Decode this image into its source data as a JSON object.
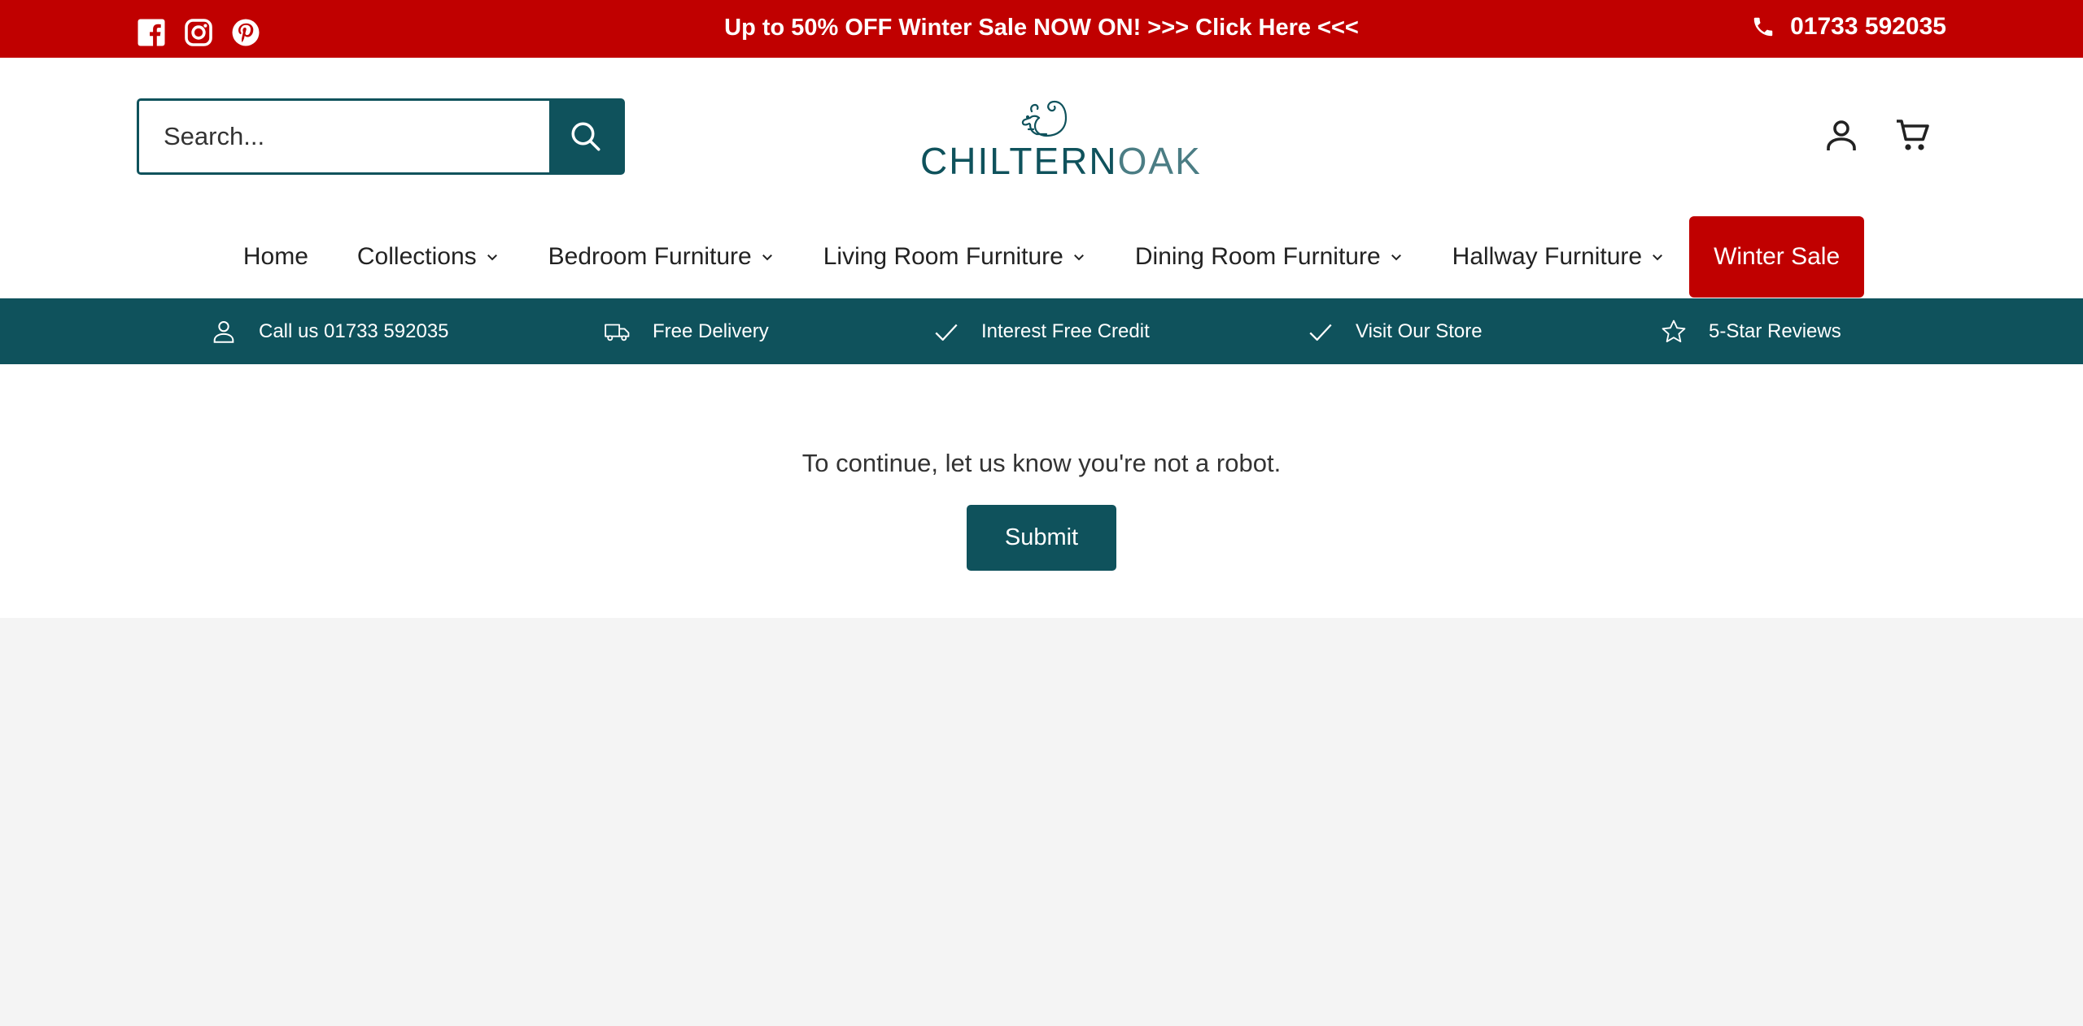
{
  "announcement": {
    "message": "Up to 50% OFF Winter Sale NOW ON! >>> Click Here <<<",
    "phone": "01733 592035",
    "social": [
      "facebook-icon",
      "instagram-icon",
      "pinterest-icon"
    ]
  },
  "header": {
    "search": {
      "placeholder": "Search..."
    },
    "logo": {
      "part1": "CHILTERN",
      "part2": "OAK"
    },
    "icons": [
      "account-icon",
      "cart-icon"
    ]
  },
  "nav": {
    "items": [
      {
        "label": "Home",
        "dropdown": false
      },
      {
        "label": "Collections",
        "dropdown": true
      },
      {
        "label": "Bedroom Furniture",
        "dropdown": true
      },
      {
        "label": "Living Room Furniture",
        "dropdown": true
      },
      {
        "label": "Dining Room Furniture",
        "dropdown": true
      },
      {
        "label": "Hallway Furniture",
        "dropdown": true
      }
    ],
    "sale_label": "Winter Sale"
  },
  "usp": {
    "items": [
      {
        "label": "Call us 01733 592035",
        "icon": "person-icon"
      },
      {
        "label": "Free Delivery",
        "icon": "truck-icon"
      },
      {
        "label": "Interest Free Credit",
        "icon": "check-icon"
      },
      {
        "label": "Visit Our Store",
        "icon": "check-icon"
      },
      {
        "label": "5-Star Reviews",
        "icon": "star-icon"
      }
    ]
  },
  "main": {
    "message": "To continue, let us know you're not a robot.",
    "submit_label": "Submit"
  },
  "colors": {
    "brand_red": "#c00000",
    "brand_teal": "#0f525c",
    "page_bg": "#f4f4f4"
  }
}
